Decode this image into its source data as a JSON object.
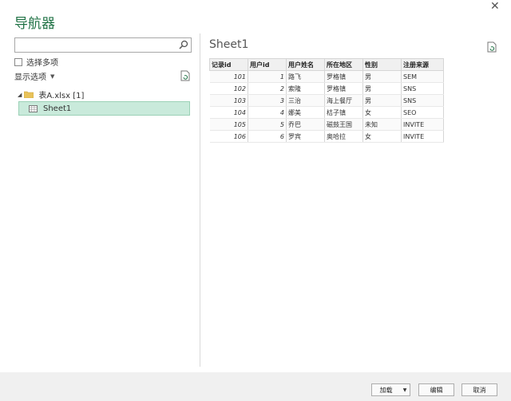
{
  "window": {
    "title": "导航器",
    "close_glyph": "✕"
  },
  "left": {
    "search": {
      "value": "",
      "placeholder": ""
    },
    "multi_select_label": "选择多项",
    "display_options_label": "显示选项",
    "tree": {
      "root_label": "表A.xlsx [1]",
      "items": [
        {
          "label": "Sheet1"
        }
      ]
    }
  },
  "preview": {
    "title": "Sheet1",
    "columns": [
      "记录id",
      "用户id",
      "用户姓名",
      "所在地区",
      "性别",
      "注册来源"
    ],
    "rows": [
      [
        "101",
        "1",
        "路飞",
        "罗格镇",
        "男",
        "SEM"
      ],
      [
        "102",
        "2",
        "索隆",
        "罗格镇",
        "男",
        "SNS"
      ],
      [
        "103",
        "3",
        "三治",
        "海上餐厅",
        "男",
        "SNS"
      ],
      [
        "104",
        "4",
        "娜美",
        "桔子镇",
        "女",
        "SEO"
      ],
      [
        "105",
        "5",
        "乔巴",
        "磁鼓王国",
        "未知",
        "INVITE"
      ],
      [
        "106",
        "6",
        "罗宾",
        "奥哈拉",
        "女",
        "INVITE"
      ]
    ]
  },
  "footer": {
    "load_label": "加载",
    "edit_label": "编辑",
    "cancel_label": "取消"
  },
  "colors": {
    "accent": "#217346",
    "selection": "#c9eadb"
  },
  "icons": [
    "search-icon",
    "refresh-icon",
    "folder-icon",
    "sheet-icon",
    "expand-triangle-icon",
    "dropdown-arrow-icon",
    "close-icon"
  ]
}
